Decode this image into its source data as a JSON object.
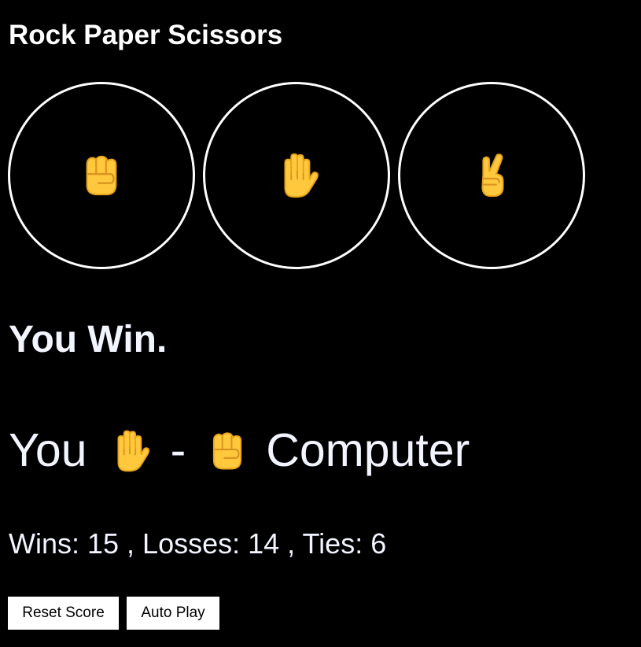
{
  "app": {
    "title": "Rock Paper Scissors"
  },
  "moves": [
    {
      "name": "rock",
      "icon": "fist-icon"
    },
    {
      "name": "paper",
      "icon": "raised-hand-icon"
    },
    {
      "name": "scissors",
      "icon": "victory-hand-icon"
    }
  ],
  "result": {
    "text": "You Win."
  },
  "round": {
    "player_label": "You",
    "player_move_icon": "raised-hand-icon",
    "separator": "-",
    "computer_move_icon": "fist-icon",
    "computer_label": "Computer"
  },
  "score": {
    "text": "Wins: 15 , Losses: 14 , Ties: 6"
  },
  "buttons": {
    "reset_label": "Reset Score",
    "auto_play_label": "Auto Play"
  },
  "colors": {
    "background": "#000000",
    "accent": "#ffffff",
    "emoji": "#ffc83d"
  }
}
